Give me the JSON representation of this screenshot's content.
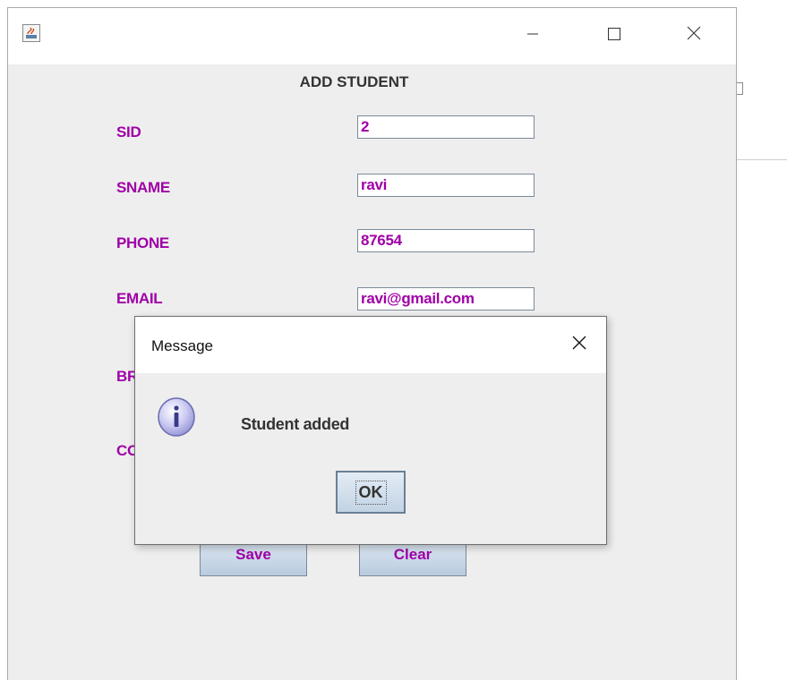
{
  "form": {
    "title": "ADD STUDENT",
    "labels": {
      "sid": "SID",
      "sname": "SNAME",
      "phone": "PHONE",
      "email": "EMAIL",
      "branch_partial": "BR",
      "course_partial": "CO"
    },
    "fields": {
      "sid": "2",
      "sname": "ravi",
      "phone": "87654",
      "email": "ravi@gmail.com"
    },
    "buttons": {
      "save": "Save",
      "clear": "Clear"
    }
  },
  "dialog": {
    "title": "Message",
    "message": "Student added",
    "ok_label": "OK",
    "icon": "info-icon"
  },
  "icons": {
    "app": "java-icon",
    "minimize": "minimize-icon",
    "maximize": "maximize-icon",
    "close": "close-icon"
  },
  "colors": {
    "label": "#a000a8",
    "frame_bg": "#eeeeee",
    "titlebar_bg": "#ffffff"
  }
}
